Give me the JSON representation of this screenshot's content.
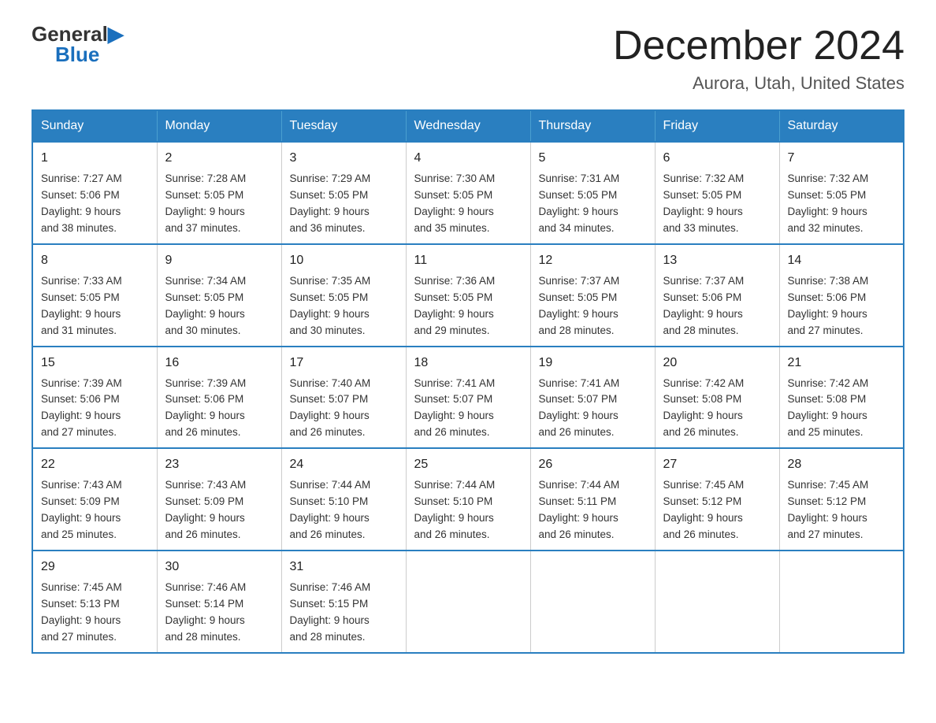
{
  "logo": {
    "general": "General",
    "blue": "Blue"
  },
  "title": "December 2024",
  "subtitle": "Aurora, Utah, United States",
  "days_header": [
    "Sunday",
    "Monday",
    "Tuesday",
    "Wednesday",
    "Thursday",
    "Friday",
    "Saturday"
  ],
  "weeks": [
    [
      {
        "day": "1",
        "sunrise": "7:27 AM",
        "sunset": "5:06 PM",
        "daylight": "9 hours and 38 minutes."
      },
      {
        "day": "2",
        "sunrise": "7:28 AM",
        "sunset": "5:05 PM",
        "daylight": "9 hours and 37 minutes."
      },
      {
        "day": "3",
        "sunrise": "7:29 AM",
        "sunset": "5:05 PM",
        "daylight": "9 hours and 36 minutes."
      },
      {
        "day": "4",
        "sunrise": "7:30 AM",
        "sunset": "5:05 PM",
        "daylight": "9 hours and 35 minutes."
      },
      {
        "day": "5",
        "sunrise": "7:31 AM",
        "sunset": "5:05 PM",
        "daylight": "9 hours and 34 minutes."
      },
      {
        "day": "6",
        "sunrise": "7:32 AM",
        "sunset": "5:05 PM",
        "daylight": "9 hours and 33 minutes."
      },
      {
        "day": "7",
        "sunrise": "7:32 AM",
        "sunset": "5:05 PM",
        "daylight": "9 hours and 32 minutes."
      }
    ],
    [
      {
        "day": "8",
        "sunrise": "7:33 AM",
        "sunset": "5:05 PM",
        "daylight": "9 hours and 31 minutes."
      },
      {
        "day": "9",
        "sunrise": "7:34 AM",
        "sunset": "5:05 PM",
        "daylight": "9 hours and 30 minutes."
      },
      {
        "day": "10",
        "sunrise": "7:35 AM",
        "sunset": "5:05 PM",
        "daylight": "9 hours and 30 minutes."
      },
      {
        "day": "11",
        "sunrise": "7:36 AM",
        "sunset": "5:05 PM",
        "daylight": "9 hours and 29 minutes."
      },
      {
        "day": "12",
        "sunrise": "7:37 AM",
        "sunset": "5:05 PM",
        "daylight": "9 hours and 28 minutes."
      },
      {
        "day": "13",
        "sunrise": "7:37 AM",
        "sunset": "5:06 PM",
        "daylight": "9 hours and 28 minutes."
      },
      {
        "day": "14",
        "sunrise": "7:38 AM",
        "sunset": "5:06 PM",
        "daylight": "9 hours and 27 minutes."
      }
    ],
    [
      {
        "day": "15",
        "sunrise": "7:39 AM",
        "sunset": "5:06 PM",
        "daylight": "9 hours and 27 minutes."
      },
      {
        "day": "16",
        "sunrise": "7:39 AM",
        "sunset": "5:06 PM",
        "daylight": "9 hours and 26 minutes."
      },
      {
        "day": "17",
        "sunrise": "7:40 AM",
        "sunset": "5:07 PM",
        "daylight": "9 hours and 26 minutes."
      },
      {
        "day": "18",
        "sunrise": "7:41 AM",
        "sunset": "5:07 PM",
        "daylight": "9 hours and 26 minutes."
      },
      {
        "day": "19",
        "sunrise": "7:41 AM",
        "sunset": "5:07 PM",
        "daylight": "9 hours and 26 minutes."
      },
      {
        "day": "20",
        "sunrise": "7:42 AM",
        "sunset": "5:08 PM",
        "daylight": "9 hours and 26 minutes."
      },
      {
        "day": "21",
        "sunrise": "7:42 AM",
        "sunset": "5:08 PM",
        "daylight": "9 hours and 25 minutes."
      }
    ],
    [
      {
        "day": "22",
        "sunrise": "7:43 AM",
        "sunset": "5:09 PM",
        "daylight": "9 hours and 25 minutes."
      },
      {
        "day": "23",
        "sunrise": "7:43 AM",
        "sunset": "5:09 PM",
        "daylight": "9 hours and 26 minutes."
      },
      {
        "day": "24",
        "sunrise": "7:44 AM",
        "sunset": "5:10 PM",
        "daylight": "9 hours and 26 minutes."
      },
      {
        "day": "25",
        "sunrise": "7:44 AM",
        "sunset": "5:10 PM",
        "daylight": "9 hours and 26 minutes."
      },
      {
        "day": "26",
        "sunrise": "7:44 AM",
        "sunset": "5:11 PM",
        "daylight": "9 hours and 26 minutes."
      },
      {
        "day": "27",
        "sunrise": "7:45 AM",
        "sunset": "5:12 PM",
        "daylight": "9 hours and 26 minutes."
      },
      {
        "day": "28",
        "sunrise": "7:45 AM",
        "sunset": "5:12 PM",
        "daylight": "9 hours and 27 minutes."
      }
    ],
    [
      {
        "day": "29",
        "sunrise": "7:45 AM",
        "sunset": "5:13 PM",
        "daylight": "9 hours and 27 minutes."
      },
      {
        "day": "30",
        "sunrise": "7:46 AM",
        "sunset": "5:14 PM",
        "daylight": "9 hours and 28 minutes."
      },
      {
        "day": "31",
        "sunrise": "7:46 AM",
        "sunset": "5:15 PM",
        "daylight": "9 hours and 28 minutes."
      },
      null,
      null,
      null,
      null
    ]
  ],
  "labels": {
    "sunrise": "Sunrise:",
    "sunset": "Sunset:",
    "daylight": "Daylight:"
  }
}
